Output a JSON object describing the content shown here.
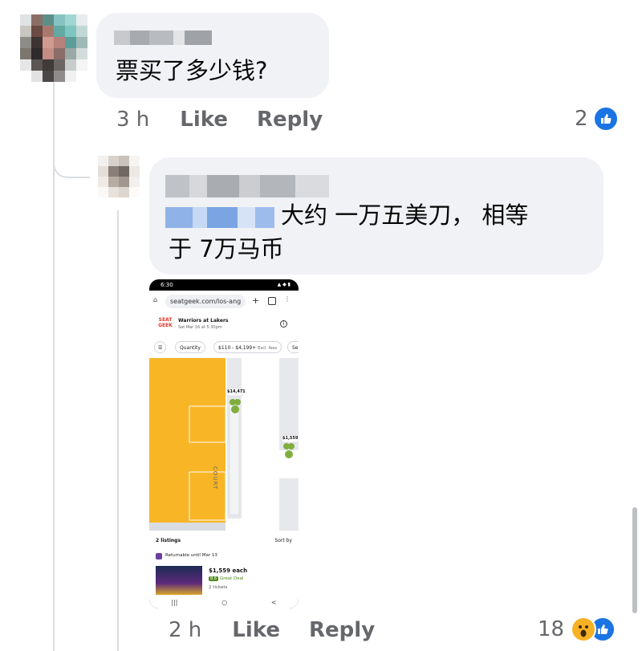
{
  "comments": [
    {
      "text": "票买了多少钱?",
      "time": "3 h",
      "like_label": "Like",
      "reply_label": "Reply",
      "reaction_count": "2"
    },
    {
      "text_line1": "大约 一万五美刀，  相等",
      "text_line2": "于 7万马币",
      "time": "2 h",
      "like_label": "Like",
      "reply_label": "Reply",
      "reaction_count": "18"
    }
  ],
  "screenshot": {
    "status_time": "6:30",
    "url": "seatgeek.com/los-ang",
    "logo_line1": "SEAT",
    "logo_line2": "GEEK",
    "event_title": "Warriors at Lakers",
    "event_date": "Sat Mar 16 at 5:30pm",
    "chips": [
      "Quantity",
      "$110 - $4,199+",
      "Excl. fees",
      "Se"
    ],
    "court_label": "COURT",
    "price_tag_1": "$14,471",
    "price_tag_2": "$1,559",
    "listings_count": "2 listings",
    "sort_label": "Sort by",
    "returnable": "Returnable until Mar 13",
    "listing_price": "$1,559 each",
    "deal_score": "8.6",
    "deal_label": "Great Deal",
    "tickets": "2 tickets",
    "nav_icons": [
      "|||",
      "○",
      "<"
    ]
  },
  "colors": {
    "bubble_bg": "#f0f2f5",
    "meta_gray": "#65676b",
    "like_blue": "#1b74e4",
    "court_orange": "#f8b526",
    "section_green": "#7fae3e"
  },
  "icons": {
    "like_reaction": "thumbs-up-icon",
    "wow_reaction": "wow-face-icon"
  }
}
